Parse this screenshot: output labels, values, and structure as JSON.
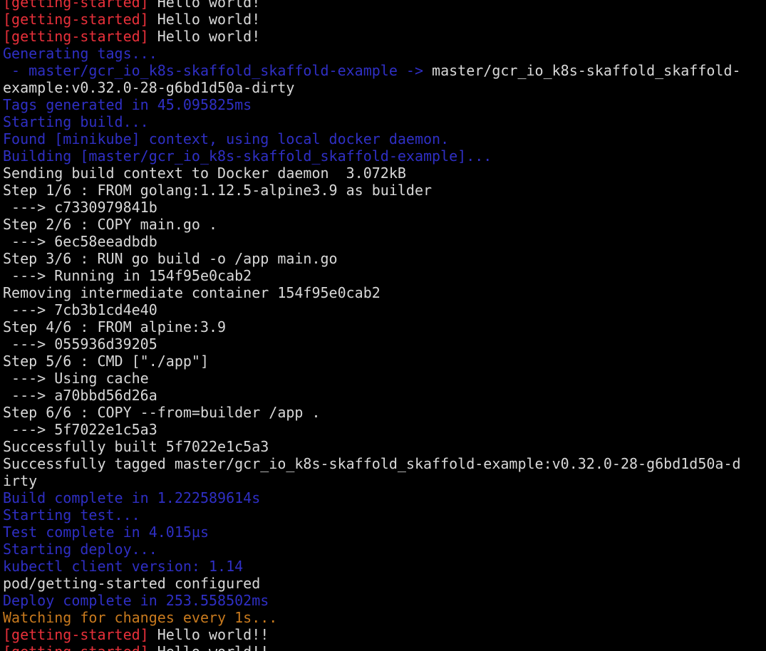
{
  "colors": {
    "background": "#000000",
    "default": "#d8d8d8",
    "red": "#e8303a",
    "blue": "#2f2fc4",
    "orange": "#c87a1e"
  },
  "lines": [
    {
      "segments": [
        {
          "text": "[getting-started]",
          "color": "red"
        },
        {
          "text": " Hello world!",
          "color": "white"
        }
      ]
    },
    {
      "segments": [
        {
          "text": "[getting-started]",
          "color": "red"
        },
        {
          "text": " Hello world!",
          "color": "white"
        }
      ]
    },
    {
      "segments": [
        {
          "text": "[getting-started]",
          "color": "red"
        },
        {
          "text": " Hello world!",
          "color": "white"
        }
      ]
    },
    {
      "segments": [
        {
          "text": "Generating tags...",
          "color": "blue"
        }
      ]
    },
    {
      "segments": [
        {
          "text": " - master/gcr_io_k8s-skaffold_skaffold-example ->",
          "color": "blue"
        },
        {
          "text": " master/gcr_io_k8s-skaffold_skaffold-",
          "color": "white"
        }
      ]
    },
    {
      "segments": [
        {
          "text": "example:v0.32.0-28-g6bd1d50a-dirty",
          "color": "white"
        }
      ]
    },
    {
      "segments": [
        {
          "text": "Tags generated in 45.095825ms",
          "color": "blue"
        }
      ]
    },
    {
      "segments": [
        {
          "text": "Starting build...",
          "color": "blue"
        }
      ]
    },
    {
      "segments": [
        {
          "text": "Found [minikube] context, using local docker daemon.",
          "color": "blue"
        }
      ]
    },
    {
      "segments": [
        {
          "text": "Building [master/gcr_io_k8s-skaffold_skaffold-example]...",
          "color": "blue"
        }
      ]
    },
    {
      "segments": [
        {
          "text": "Sending build context to Docker daemon  3.072kB",
          "color": "white"
        }
      ]
    },
    {
      "segments": [
        {
          "text": "Step 1/6 : FROM golang:1.12.5-alpine3.9 as builder",
          "color": "white"
        }
      ]
    },
    {
      "segments": [
        {
          "text": " ---> c7330979841b",
          "color": "white"
        }
      ]
    },
    {
      "segments": [
        {
          "text": "Step 2/6 : COPY main.go .",
          "color": "white"
        }
      ]
    },
    {
      "segments": [
        {
          "text": " ---> 6ec58eeadbdb",
          "color": "white"
        }
      ]
    },
    {
      "segments": [
        {
          "text": "Step 3/6 : RUN go build -o /app main.go",
          "color": "white"
        }
      ]
    },
    {
      "segments": [
        {
          "text": " ---> Running in 154f95e0cab2",
          "color": "white"
        }
      ]
    },
    {
      "segments": [
        {
          "text": "Removing intermediate container 154f95e0cab2",
          "color": "white"
        }
      ]
    },
    {
      "segments": [
        {
          "text": " ---> 7cb3b1cd4e40",
          "color": "white"
        }
      ]
    },
    {
      "segments": [
        {
          "text": "Step 4/6 : FROM alpine:3.9",
          "color": "white"
        }
      ]
    },
    {
      "segments": [
        {
          "text": " ---> 055936d39205",
          "color": "white"
        }
      ]
    },
    {
      "segments": [
        {
          "text": "Step 5/6 : CMD [\"./app\"]",
          "color": "white"
        }
      ]
    },
    {
      "segments": [
        {
          "text": " ---> Using cache",
          "color": "white"
        }
      ]
    },
    {
      "segments": [
        {
          "text": " ---> a70bbd56d26a",
          "color": "white"
        }
      ]
    },
    {
      "segments": [
        {
          "text": "Step 6/6 : COPY --from=builder /app .",
          "color": "white"
        }
      ]
    },
    {
      "segments": [
        {
          "text": " ---> 5f7022e1c5a3",
          "color": "white"
        }
      ]
    },
    {
      "segments": [
        {
          "text": "Successfully built 5f7022e1c5a3",
          "color": "white"
        }
      ]
    },
    {
      "segments": [
        {
          "text": "Successfully tagged master/gcr_io_k8s-skaffold_skaffold-example:v0.32.0-28-g6bd1d50a-d",
          "color": "white"
        }
      ]
    },
    {
      "segments": [
        {
          "text": "irty",
          "color": "white"
        }
      ]
    },
    {
      "segments": [
        {
          "text": "Build complete in 1.222589614s",
          "color": "blue"
        }
      ]
    },
    {
      "segments": [
        {
          "text": "Starting test...",
          "color": "blue"
        }
      ]
    },
    {
      "segments": [
        {
          "text": "Test complete in 4.015µs",
          "color": "blue"
        }
      ]
    },
    {
      "segments": [
        {
          "text": "Starting deploy...",
          "color": "blue"
        }
      ]
    },
    {
      "segments": [
        {
          "text": "kubectl client version: 1.14",
          "color": "blue"
        }
      ]
    },
    {
      "segments": [
        {
          "text": "pod/getting-started configured",
          "color": "white"
        }
      ]
    },
    {
      "segments": [
        {
          "text": "Deploy complete in 253.558502ms",
          "color": "blue"
        }
      ]
    },
    {
      "segments": [
        {
          "text": "Watching for changes every 1s...",
          "color": "orange"
        }
      ]
    },
    {
      "segments": [
        {
          "text": "[getting-started]",
          "color": "red"
        },
        {
          "text": " Hello world!!",
          "color": "white"
        }
      ]
    },
    {
      "segments": [
        {
          "text": "[getting-started]",
          "color": "red"
        },
        {
          "text": " Hello world!!",
          "color": "white"
        }
      ]
    }
  ]
}
